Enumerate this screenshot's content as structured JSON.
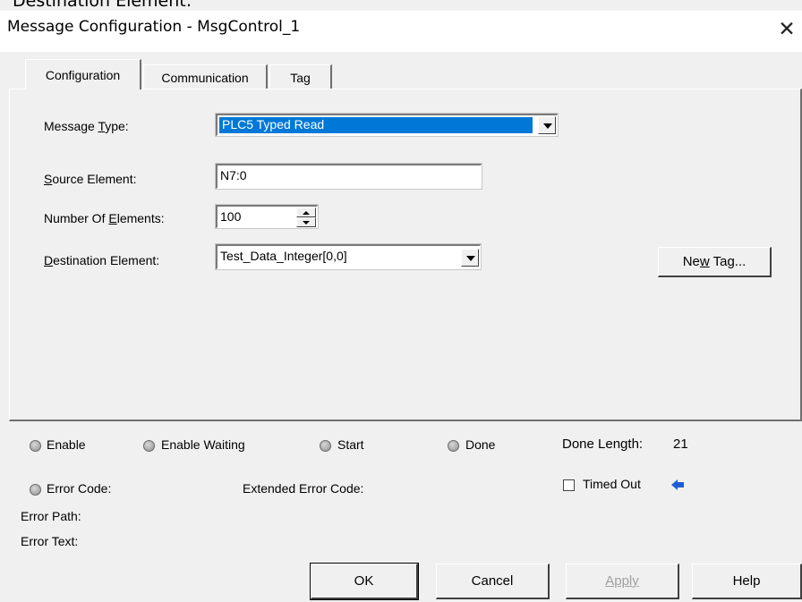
{
  "page_heading": "Destination Element:",
  "window": {
    "title": "Message Configuration - MsgControl_1",
    "close_glyph": "✕"
  },
  "tabs": [
    {
      "label": "Configuration",
      "active": true
    },
    {
      "label": "Communication",
      "active": false
    },
    {
      "label": "Tag",
      "active": false
    }
  ],
  "config": {
    "message_type": {
      "label_pre": "Message ",
      "label_key": "T",
      "label_post": "ype:",
      "value": "PLC5 Typed Read"
    },
    "source_element": {
      "label_key": "S",
      "label_post": "ource Element:",
      "value": "N7:0"
    },
    "num_elements": {
      "label_pre": "Number Of ",
      "label_key": "E",
      "label_post": "lements:",
      "value": "100"
    },
    "destination_element": {
      "label_key": "D",
      "label_post": "estination Element:",
      "value": "Test_Data_Integer[0,0]"
    },
    "new_tag_button": {
      "pre": "Ne",
      "key": "w",
      "post": " Tag..."
    }
  },
  "status": {
    "enable": "Enable",
    "enable_waiting": "Enable Waiting",
    "start": "Start",
    "done": "Done",
    "done_length_label": "Done Length:",
    "done_length_value": "21",
    "error_code": "Error Code:",
    "extended_error_code": "Extended Error Code:",
    "timed_out": "Timed Out",
    "timed_out_checked": false,
    "error_path": "Error Path:",
    "error_text": "Error Text:"
  },
  "buttons": {
    "ok": "OK",
    "cancel": "Cancel",
    "apply": "Apply",
    "help": "Help"
  },
  "colors": {
    "selection": "#0078d7",
    "accent_arrow": "#1f5fd6"
  }
}
